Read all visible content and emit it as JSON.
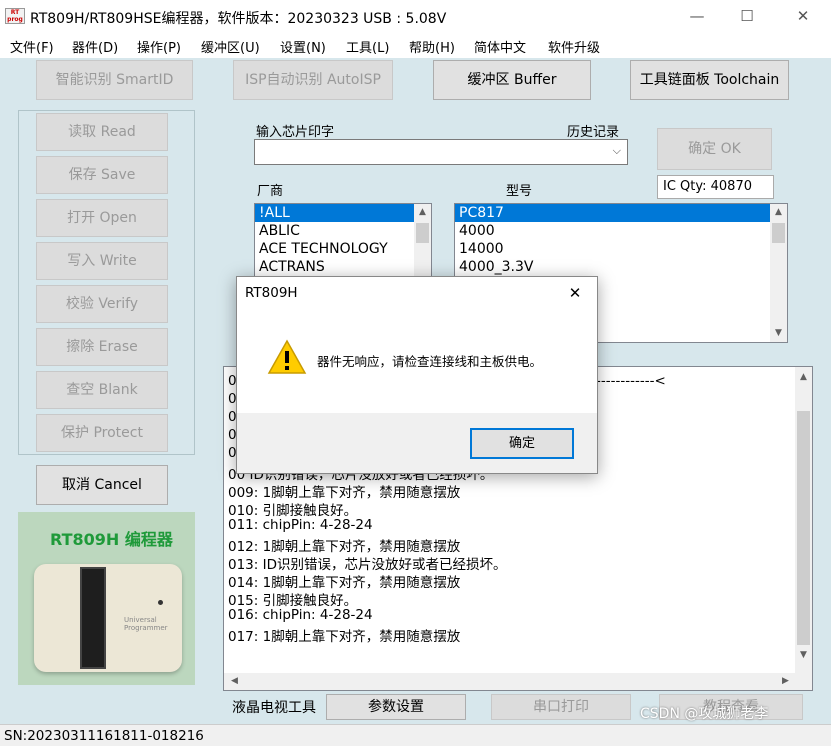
{
  "window": {
    "icon_text": "RT\nprog",
    "title": "RT809H/RT809HSE编程器，软件版本：20230323  USB : 5.08V",
    "minimize": "—",
    "maximize": "☐",
    "close": "✕"
  },
  "menu": [
    "文件(F)",
    "器件(D)",
    "操作(P)",
    "缓冲区(U)",
    "设置(N)",
    "工具(L)",
    "帮助(H)",
    "简体中文",
    "软件升级"
  ],
  "top_buttons": {
    "smartid": "智能识别 SmartID",
    "autoisp": "ISP自动识别 AutoISP",
    "buffer": "缓冲区 Buffer",
    "toolchain": "工具链面板 Toolchain"
  },
  "side_buttons": [
    "读取 Read",
    "保存 Save",
    "打开 Open",
    "写入 Write",
    "校验 Verify",
    "擦除 Erase",
    "查空 Blank",
    "保护 Protect"
  ],
  "cancel_button": "取消 Cancel",
  "chip_input": {
    "label": "输入芯片印字",
    "history_label": "历史记录",
    "value": "",
    "ok_button": "确定 OK",
    "ic_qty": "IC Qty: 40870"
  },
  "vendor": {
    "label": "厂商",
    "items": [
      "!ALL",
      "ABLIC",
      "ACE TECHNOLOGY",
      "ACTRANS"
    ],
    "selected": 0
  },
  "model": {
    "label": "型号",
    "items": [
      "PC817",
      "4000",
      "14000",
      "4000_3.3V"
    ],
    "selected": 0
  },
  "log": {
    "hidden_prefixes": [
      "00",
      "00",
      "00",
      "00",
      "00",
      "00"
    ],
    "visible_tail": "------------<",
    "partial_line": "00 ID识别错误，芯片没放好或者已经损坏。",
    "lines": [
      "009: 1脚朝上靠下对齐，禁用随意摆放",
      "010: 引脚接触良好。",
      "011: chipPin: 4-28-24",
      "012: 1脚朝上靠下对齐，禁用随意摆放",
      "013: ID识别错误，芯片没放好或者已经损坏。",
      "014: 1脚朝上靠下对齐，禁用随意摆放",
      "015: 引脚接触良好。",
      "016: chipPin: 4-28-24",
      "017: 1脚朝上靠下对齐，禁用随意摆放"
    ]
  },
  "bottom_bar": {
    "lcd_tool": "液晶电视工具",
    "params": "参数设置",
    "serial_print": "串口打印",
    "tutorial": "教程查看"
  },
  "product": {
    "title": "RT809H 编程器",
    "device_label": "Universal\nProgrammer"
  },
  "status": {
    "sn": "SN:20230311161811-018216",
    "watermark": "CSDN @攻城狮老李"
  },
  "dialog": {
    "title": "RT809H",
    "message": "器件无响应，请检查连接线和主板供电。",
    "ok": "确定"
  },
  "colors": {
    "accent": "#0078d7",
    "background": "#d7e7ec",
    "product_title": "#1f9a3a"
  }
}
